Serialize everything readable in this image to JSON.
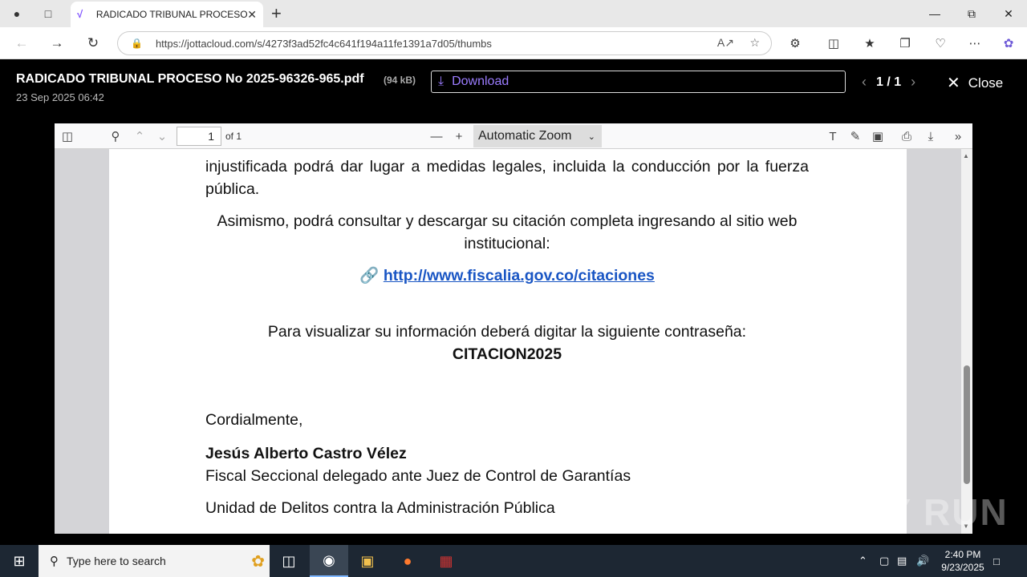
{
  "browser": {
    "tab_title": "RADICADO TRIBUNAL PROCESO N",
    "tab_favicon": "jottacloud-icon",
    "url": "https://jottacloud.com/s/4273f3ad52fc4c641f194a11fe1391a7d05/thumbs",
    "window_controls": [
      "minimize",
      "maximize",
      "close"
    ]
  },
  "viewer": {
    "file_name": "RADICADO TRIBUNAL PROCESO No 2025-96326-965.pdf",
    "file_size": "(94 kB)",
    "date": "23 Sep 2025 06:42",
    "download_label": "Download",
    "page_counter": "1 / 1",
    "close_label": "Close",
    "accent_color": "#9b7cff"
  },
  "pdf_toolbar": {
    "page_number": "1",
    "page_of": "of 1",
    "zoom": "Automatic Zoom"
  },
  "document": {
    "para1": "injustificada podrá dar lugar a medidas legales, incluida la conducción por la fuerza pública.",
    "para2": "Asimismo, podrá consultar y descargar su citación completa ingresando al sitio web institucional:",
    "link_icon": "🔗",
    "link": "http://www.fiscalia.gov.co/citaciones",
    "password_prompt": "Para visualizar su información deberá digitar la siguiente contraseña:",
    "password": "CITACION2025",
    "closing": "Cordialmente,",
    "signer_name": "Jesús Alberto Castro Vélez",
    "signer_title": "Fiscal Seccional delegado ante Juez de Control de Garantías",
    "signer_unit": "Unidad de Delitos contra la Administración Pública"
  },
  "watermark": "ANY RUN",
  "taskbar": {
    "search_placeholder": "Type here to search",
    "time": "2:40 PM",
    "date": "9/23/2025"
  }
}
